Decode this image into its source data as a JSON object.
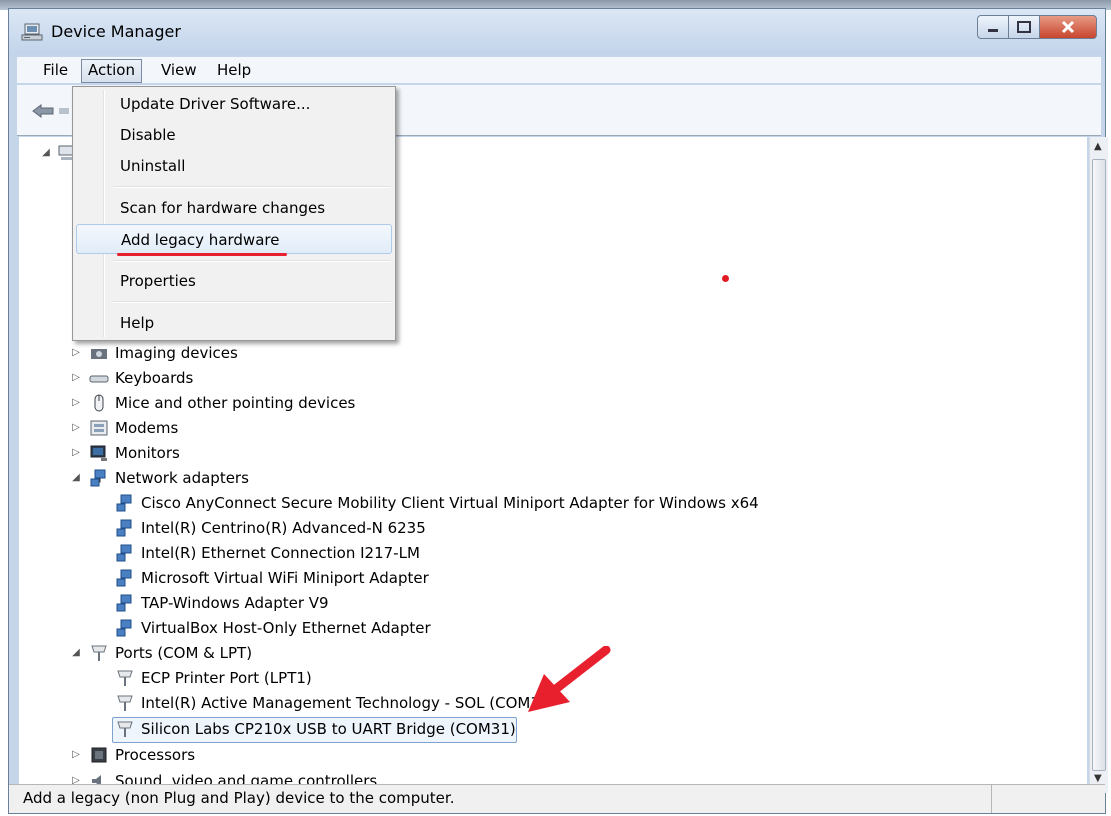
{
  "window": {
    "title": "Device Manager",
    "buttons": {
      "minimize": "minimize",
      "maximize": "maximize",
      "close": "close"
    }
  },
  "menubar": {
    "file": "File",
    "action": "Action",
    "view": "View",
    "help": "Help"
  },
  "action_menu": {
    "items": [
      "Update Driver Software...",
      "Disable",
      "Uninstall",
      "Scan for hardware changes",
      "Add legacy hardware",
      "Properties",
      "Help"
    ]
  },
  "tree": {
    "imaging": "Imaging devices",
    "keyboards": "Keyboards",
    "mice": "Mice and other pointing devices",
    "modems": "Modems",
    "monitors": "Monitors",
    "network": "Network adapters",
    "network_children": [
      "Cisco AnyConnect Secure Mobility Client Virtual Miniport Adapter for Windows x64",
      "Intel(R) Centrino(R) Advanced-N 6235",
      "Intel(R) Ethernet Connection I217-LM",
      "Microsoft Virtual WiFi Miniport Adapter",
      "TAP-Windows Adapter V9",
      "VirtualBox Host-Only Ethernet Adapter"
    ],
    "ports": "Ports (COM & LPT)",
    "ports_children": [
      "ECP Printer Port (LPT1)",
      "Intel(R) Active Management Technology - SOL (COM3)",
      "Silicon Labs CP210x USB to UART Bridge (COM31)"
    ],
    "processors": "Processors",
    "sound": "Sound, video and game controllers"
  },
  "statusbar": {
    "text": "Add a legacy (non Plug and Play) device to the computer."
  },
  "colors": {
    "annotation_red": "#e8202e",
    "selection_border": "#7da2ce"
  }
}
